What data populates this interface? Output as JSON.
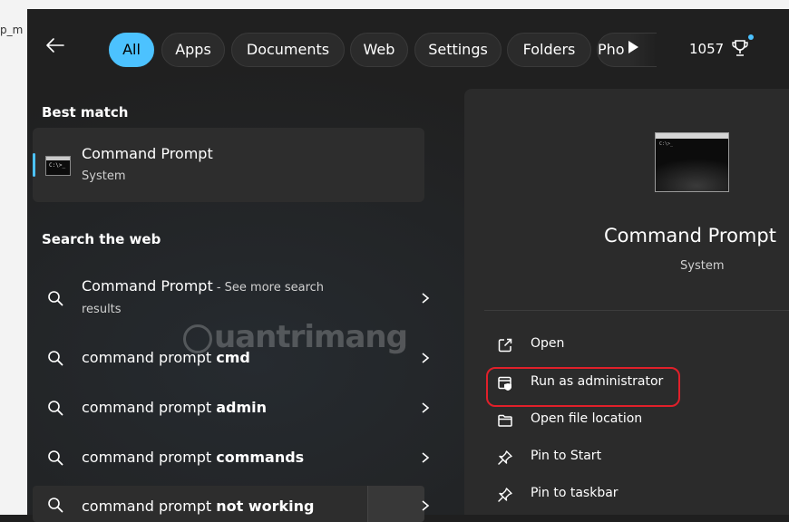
{
  "background": {
    "page_fragment": "p_m"
  },
  "filter_bar": {
    "tabs": [
      {
        "label": "All",
        "active": true
      },
      {
        "label": "Apps"
      },
      {
        "label": "Documents"
      },
      {
        "label": "Web"
      },
      {
        "label": "Settings"
      },
      {
        "label": "Folders"
      },
      {
        "label": "Pho"
      }
    ],
    "rewards_points": "1057"
  },
  "best_match": {
    "heading": "Best match",
    "item": {
      "title": "Command Prompt",
      "subtitle": "System"
    }
  },
  "search_web": {
    "heading": "Search the web",
    "items": [
      {
        "query": "Command Prompt",
        "suffix": " - See more search",
        "suffix2": "results"
      },
      {
        "prefix": "command prompt ",
        "bold": "cmd"
      },
      {
        "prefix": "command prompt ",
        "bold": "admin"
      },
      {
        "prefix": "command prompt ",
        "bold": "commands"
      },
      {
        "prefix": "command prompt ",
        "bold": "not working"
      }
    ]
  },
  "watermark": {
    "text": "uantrimang"
  },
  "details": {
    "title": "Command Prompt",
    "subtitle": "System",
    "actions": [
      {
        "label": "Open",
        "icon": "open-external-icon"
      },
      {
        "label": "Run as administrator",
        "icon": "shield-window-icon",
        "highlighted": true
      },
      {
        "label": "Open file location",
        "icon": "folder-icon"
      },
      {
        "label": "Pin to Start",
        "icon": "pin-icon"
      },
      {
        "label": "Pin to taskbar",
        "icon": "pin-icon"
      }
    ]
  },
  "colors": {
    "accent": "#4cc2ff",
    "panel": "#202020",
    "card": "#2d2d2d",
    "highlight_outline": "#e0202a"
  }
}
